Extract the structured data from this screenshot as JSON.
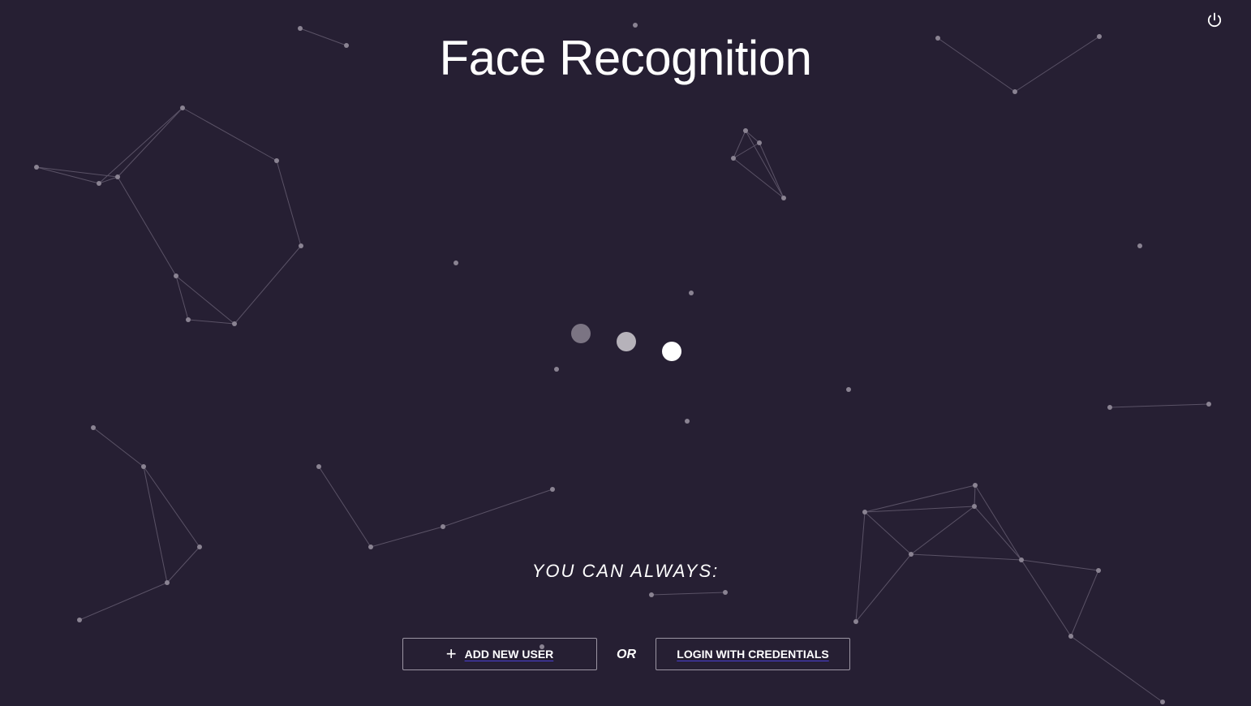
{
  "app": {
    "title": "Face Recognition"
  },
  "header": {
    "power_icon": "power-icon"
  },
  "loader": {
    "dots": 3
  },
  "actions": {
    "tagline": "YOU CAN ALWAYS:",
    "add_user_label": "ADD NEW USER",
    "add_user_icon": "plus-icon",
    "or_label": "OR",
    "login_label": "LOGIN WITH CREDENTIALS"
  },
  "theme": {
    "background": "#261f33",
    "text": "#ffffff",
    "node": "#8a8392",
    "edge": "#5a5266",
    "link_underline": "#4b3fd6"
  }
}
